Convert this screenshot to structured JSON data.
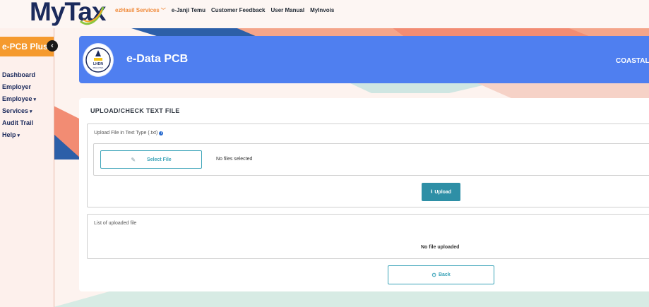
{
  "header": {
    "logo_text": "MyTax",
    "nav": [
      {
        "label": "ezHasil Services",
        "active": true
      },
      {
        "label": "e-Janji Temu",
        "active": false
      },
      {
        "label": "Customer Feedback",
        "active": false
      },
      {
        "label": "User Manual",
        "active": false
      },
      {
        "label": "MyInvois",
        "active": false
      }
    ]
  },
  "sidebar": {
    "brand": "e-PCB Plus",
    "items": [
      {
        "label": "Dashboard"
      },
      {
        "label": "Employer"
      },
      {
        "label": "Employee",
        "caret": "▾"
      },
      {
        "label": "Services",
        "caret": "▾"
      },
      {
        "label": "Audit Trail"
      },
      {
        "label": "Help",
        "caret": "▾"
      }
    ]
  },
  "banner": {
    "title": "e-Data PCB",
    "right_text": "COASTAL",
    "emblem_text": "LHDN",
    "emblem_sub": "MALAYSIA"
  },
  "card": {
    "title": "UPLOAD/CHECK TEXT FILE",
    "upload_label": "Upload File in Text Type (.txt)",
    "select_file_label": "Select File",
    "no_files_text": "No files selected",
    "upload_button_label": "Upload",
    "list_label": "List of uploaded file",
    "no_uploaded_text": "No file uploaded",
    "back_button_label": "Back"
  },
  "colors": {
    "brand_orange": "#f59a2e",
    "banner_blue": "#4f7ff0",
    "teal": "#2e8fa6",
    "navy": "#1b2a5c"
  }
}
